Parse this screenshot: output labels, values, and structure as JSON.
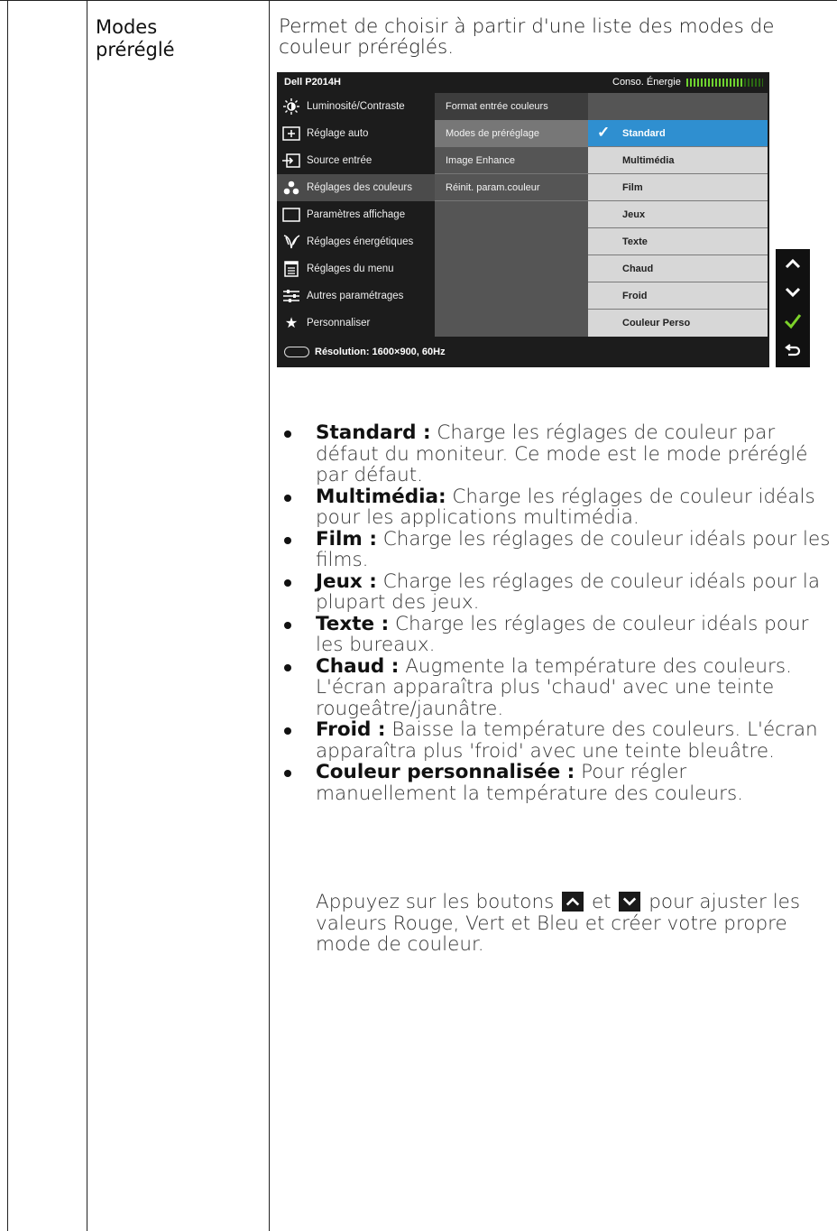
{
  "label": {
    "line1": "Modes",
    "line2": "préréglé"
  },
  "intro": "Permet de choisir à partir d'une liste des modes de couleur préréglés.",
  "osd": {
    "model": "Dell P2014H",
    "energy_label": "Conso. Énergie",
    "menu": [
      {
        "label": "Luminosité/Contraste",
        "icon": "brightness-icon"
      },
      {
        "label": "Réglage auto",
        "icon": "auto-adjust-icon"
      },
      {
        "label": "Source entrée",
        "icon": "input-source-icon"
      },
      {
        "label": "Réglages des couleurs",
        "icon": "color-dots-icon"
      },
      {
        "label": "Paramètres affichage",
        "icon": "display-icon"
      },
      {
        "label": "Réglages énergétiques",
        "icon": "energy-leaf-icon"
      },
      {
        "label": "Réglages du menu",
        "icon": "menu-icon"
      },
      {
        "label": "Autres paramétrages",
        "icon": "sliders-icon"
      },
      {
        "label": "Personnaliser",
        "icon": "star-icon"
      }
    ],
    "submenu": [
      "Format entrée couleurs",
      "Modes de préréglage",
      "Image Enhance",
      "Réinit. param.couleur"
    ],
    "options": [
      "Standard",
      "Multimédia",
      "Film",
      "Jeux",
      "Texte",
      "Chaud",
      "Froid",
      "Couleur Perso"
    ],
    "resolution": "Résolution:  1600×900, 60Hz",
    "colors": {
      "selected": "#2f8fd0",
      "energy": "#6fd42f",
      "check": "#7cd22a"
    }
  },
  "bullets": [
    {
      "term": "Standard :",
      "text": " Charge les réglages de couleur par défaut du moniteur. Ce mode est le mode préréglé par défaut."
    },
    {
      "term": "Multimédia:",
      "text": " Charge les réglages de couleur idéals pour les applications multimédia."
    },
    {
      "term": "Film :",
      "text": " Charge les réglages de couleur idéals pour les films."
    },
    {
      "term": "Jeux :",
      "text": " Charge les réglages de couleur idéals pour la plupart des jeux."
    },
    {
      "term": "Texte :",
      "text": " Charge les réglages de couleur idéals pour les bureaux."
    },
    {
      "term": "Chaud :",
      "text": " Augmente la température des couleurs. L'écran apparaîtra plus 'chaud' avec une teinte rougeâtre/jaunâtre."
    },
    {
      "term": "Froid :",
      "text": " Baisse la température des couleurs. L'écran apparaîtra plus 'froid' avec une teinte bleuâtre."
    },
    {
      "term": "Couleur personnalisée :",
      "text": " Pour régler manuellement la température des couleurs."
    }
  ],
  "note": {
    "before": "Appuyez sur les boutons ",
    "and": " et ",
    "after": " pour ajuster les valeurs Rouge, Vert et Bleu et créer votre propre mode de couleur."
  }
}
